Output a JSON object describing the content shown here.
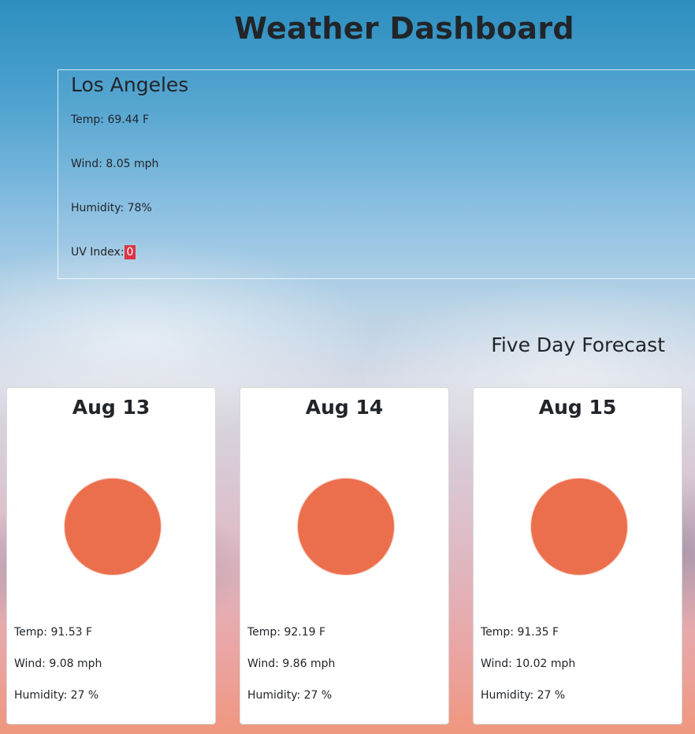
{
  "page": {
    "title": "Weather Dashboard"
  },
  "current": {
    "city": "Los Angeles",
    "temp": "Temp: 69.44 F",
    "wind": "Wind: 8.05 mph",
    "humidity": "Humidity: 78%",
    "uv_label": "UV Index:",
    "uv_value": "0",
    "uv_color": "#dc3545"
  },
  "forecast": {
    "heading": "Five Day Forecast",
    "icon_name": "sun-icon",
    "icon_color": "#ec6f4d",
    "days": [
      {
        "date": "Aug 13",
        "temp": "Temp: 91.53 F",
        "wind": "Wind: 9.08 mph",
        "humidity": "Humidity: 27 %"
      },
      {
        "date": "Aug 14",
        "temp": "Temp: 92.19 F",
        "wind": "Wind: 9.86 mph",
        "humidity": "Humidity: 27 %"
      },
      {
        "date": "Aug 15",
        "temp": "Temp: 91.35 F",
        "wind": "Wind: 10.02 mph",
        "humidity": "Humidity: 27 %"
      }
    ]
  }
}
